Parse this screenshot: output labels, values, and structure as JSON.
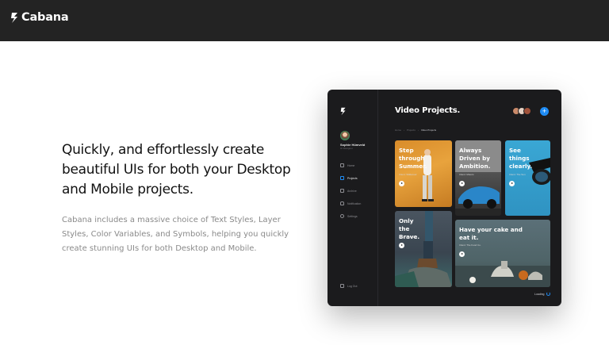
{
  "site": {
    "brand": "Cabana"
  },
  "hero": {
    "headline": "Quickly, and effortlessly create beautiful UIs for both your Desktop and Mobile projects.",
    "body": "Cabana includes a massive choice of Text Styles, Layer Styles, Color Variables, and Symbols, helping you quickly create stunning UIs for both Desktop and Mobile."
  },
  "mockup": {
    "title": "Video Projects.",
    "user": {
      "name": "Sophie Hümveld",
      "role": "UI Designer"
    },
    "nav": [
      {
        "label": "Home",
        "icon": "home-icon"
      },
      {
        "label": "Projects",
        "icon": "folder-icon",
        "active": true
      },
      {
        "label": "Archive",
        "icon": "archive-icon"
      },
      {
        "label": "Notification",
        "icon": "bell-icon"
      },
      {
        "label": "Settings",
        "icon": "gear-icon"
      }
    ],
    "logout": "Log Out",
    "breadcrumb": [
      "Home",
      "Projects",
      "Video Projects"
    ],
    "add_button": "+",
    "cards": [
      {
        "title": "Step through Summer.",
        "subtitle": "Client: Wildwood"
      },
      {
        "title": "Always Driven by Ambition.",
        "subtitle": "Client: Motors"
      },
      {
        "title": "See things clearly.",
        "subtitle": "Client: The Sun"
      },
      {
        "title": "Only the Brave.",
        "subtitle": "Client: Pathfinder"
      },
      {
        "title": "Have your cake and eat it.",
        "subtitle": "Client: The Food Co."
      }
    ],
    "loading": "Loading",
    "colors": {
      "accent": "#1f8cf5",
      "panel": "#1b1b1d"
    }
  }
}
